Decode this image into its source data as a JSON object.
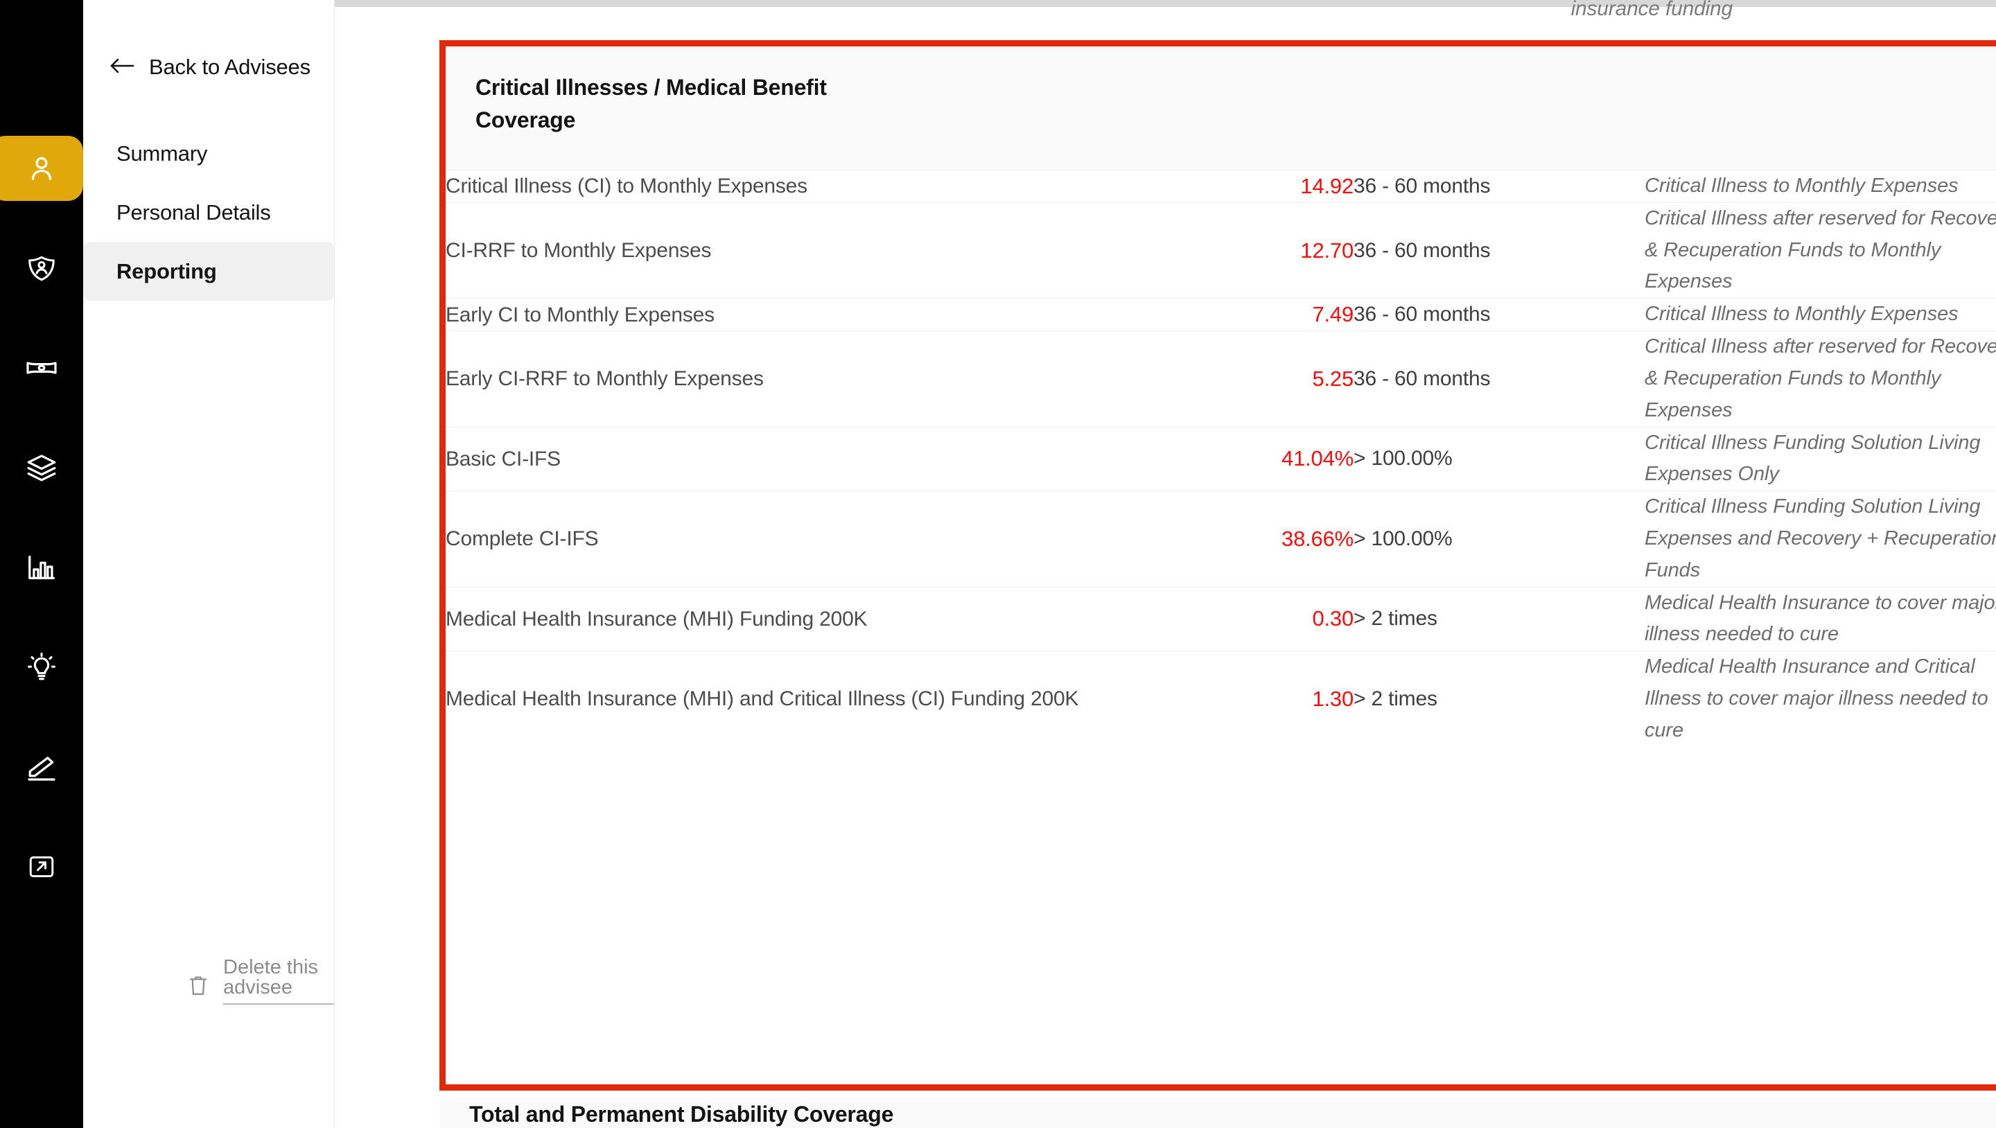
{
  "rail": {
    "items": [
      {
        "name": "person-icon",
        "label": "Advisees",
        "active": true
      },
      {
        "name": "shield-person-icon",
        "label": "Protection",
        "active": false
      },
      {
        "name": "banknote-icon",
        "label": "Cashflow",
        "active": false
      },
      {
        "name": "layers-icon",
        "label": "Assets",
        "active": false
      },
      {
        "name": "bar-chart-icon",
        "label": "Analytics",
        "active": false
      },
      {
        "name": "lightbulb-icon",
        "label": "Insights",
        "active": false
      },
      {
        "name": "pencil-icon",
        "label": "Planning",
        "active": false
      },
      {
        "name": "logout-icon",
        "label": "Sign out",
        "active": false
      }
    ]
  },
  "sidebar": {
    "back_label": "Back to Advisees",
    "nav": [
      {
        "label": "Summary",
        "selected": false
      },
      {
        "label": "Personal Details",
        "selected": false
      },
      {
        "label": "Reporting",
        "selected": true
      }
    ],
    "delete_label": "Delete this advisee"
  },
  "main": {
    "clipped_top_note": "insurance funding",
    "next_section_title": "Total and Permanent Disability Coverage",
    "highlight_color": "#E3280A"
  },
  "card": {
    "title": "Critical Illnesses / Medical Benefit Coverage",
    "rows": [
      {
        "label": "Critical Illness (CI) to Monthly Expenses",
        "value": "14.92",
        "benchmark": "36 - 60 months",
        "description": "Critical Illness to Monthly Expenses"
      },
      {
        "label": "CI-RRF to Monthly Expenses",
        "value": "12.70",
        "benchmark": "36 - 60 months",
        "description": "Critical Illness after reserved for Recovery & Recuperation Funds to Monthly Expenses"
      },
      {
        "label": "Early CI to Monthly Expenses",
        "value": "7.49",
        "benchmark": "36 - 60 months",
        "description": "Critical Illness to Monthly Expenses"
      },
      {
        "label": "Early CI-RRF to Monthly Expenses",
        "value": "5.25",
        "benchmark": "36 - 60 months",
        "description": "Critical Illness after reserved for Recovery & Recuperation Funds to Monthly Expenses"
      },
      {
        "label": "Basic CI-IFS",
        "value": "41.04%",
        "benchmark": "> 100.00%",
        "description": "Critical Illness Funding Solution Living Expenses Only"
      },
      {
        "label": "Complete CI-IFS",
        "value": "38.66%",
        "benchmark": "> 100.00%",
        "description": "Critical Illness Funding Solution Living Expenses and Recovery + Recuperation Funds"
      },
      {
        "label": "Medical Health Insurance (MHI) Funding 200K",
        "value": "0.30",
        "benchmark": "> 2 times",
        "description": "Medical Health Insurance to cover major illness needed to cure"
      },
      {
        "label": "Medical Health Insurance (MHI) and Critical Illness (CI) Funding 200K",
        "value": "1.30",
        "benchmark": "> 2 times",
        "description": "Medical Health Insurance and Critical Illness to cover major illness needed to cure"
      }
    ]
  }
}
